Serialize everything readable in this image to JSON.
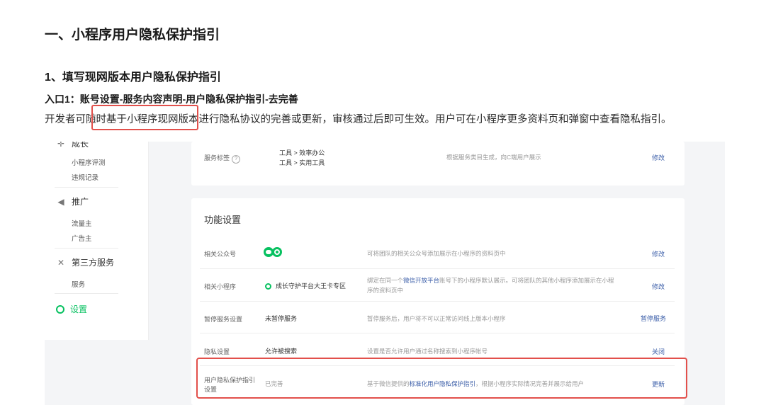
{
  "doc": {
    "h1": "一、小程序用户隐私保护指引",
    "h2": "1、填写现网版本用户隐私保护指引",
    "h3": "入口1：账号设置-服务内容声明-用户隐私保护指引-去完善",
    "para": "开发者可随时基于小程序现网版本进行隐私协议的完善或更新，审核通过后即可生效。用户可在小程序更多资料页和弹窗中查看隐私指引。"
  },
  "sidebar": {
    "growth_section_label": "成长",
    "growth_items": [
      "小程序评测",
      "违规记录"
    ],
    "promo_label": "推广",
    "promo_items": [
      "流量主",
      "广告主"
    ],
    "third_label": "第三方服务",
    "third_items": [
      "服务"
    ],
    "settings_label": "设置"
  },
  "card1": {
    "label": "服务标签",
    "value1": "工具 > 效率办公",
    "value2": "工具 > 实用工具",
    "desc": "根据服务类目生成，向C端用户展示",
    "action": "修改"
  },
  "card2": {
    "title": "功能设置",
    "rows": [
      {
        "label": "相关公众号",
        "value": "",
        "desc": "可将团队的相关公众号添加展示在小程序的资料页中",
        "action": "修改"
      },
      {
        "label": "相关小程序",
        "value": "成长守护平台大王卡专区",
        "desc_a": "绑定在同一个",
        "desc_link": "微信开放平台",
        "desc_b": "账号下的小程序默认展示。可将团队的其他小程序添加展示在小程",
        "desc_c": "序的资料页中",
        "action": "修改"
      },
      {
        "label": "暂停服务设置",
        "value": "未暂停服务",
        "desc": "暂停服务后，用户将不可以正常访问线上版本小程序",
        "action": "暂停服务"
      },
      {
        "label": "隐私设置",
        "value": "允许被搜索",
        "desc": "设置是否允许用户通过名称搜索到小程序帐号",
        "action": "关闭"
      },
      {
        "label_a": "用户隐私保护指引",
        "label_b": "设置",
        "value": "已完善",
        "desc_a": "基于微信提供的",
        "desc_link": "标准化用户隐私保护指引",
        "desc_b": "，根据小程序实际情况完善并展示给用户",
        "action": "更新"
      }
    ]
  },
  "colors": {
    "accent": "#07c160",
    "link": "#3a5da8",
    "highlight": "#e2504b"
  }
}
